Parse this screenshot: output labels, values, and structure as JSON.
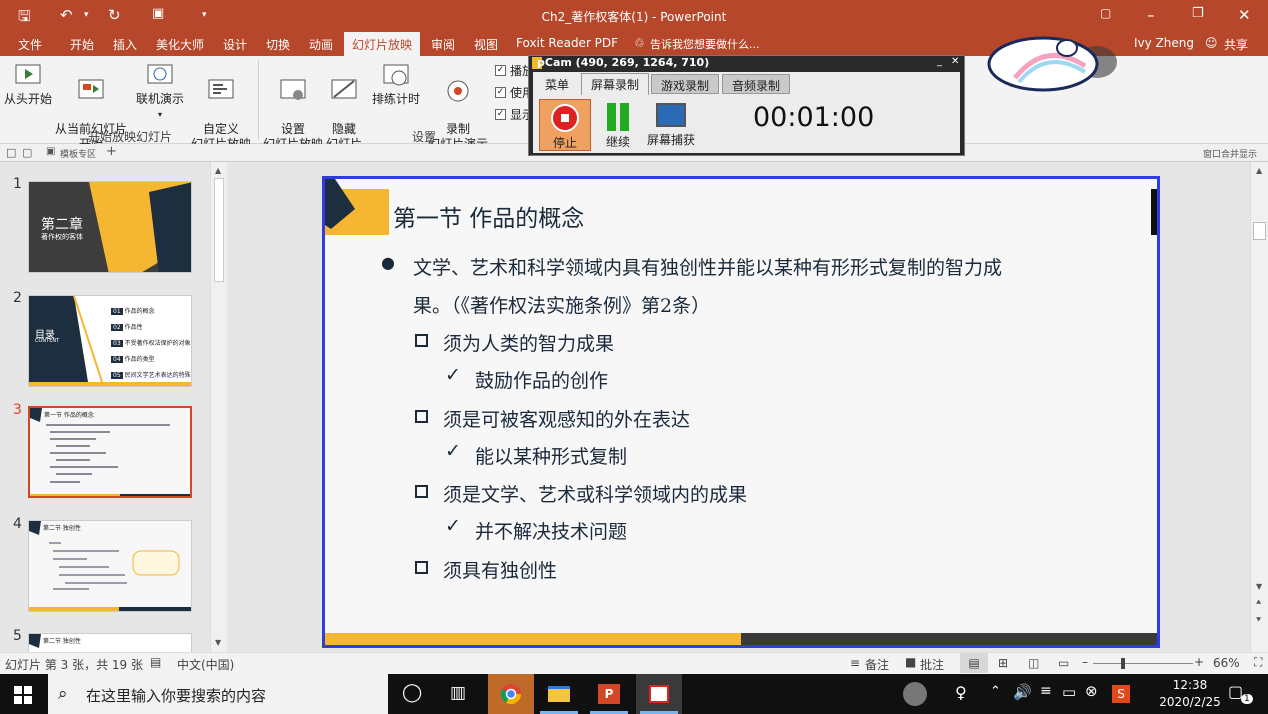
{
  "window": {
    "title": "Ch2_著作权客体(1)  -  PowerPoint",
    "user": "Ivy Zheng",
    "share_label": "共享"
  },
  "menu": {
    "items": [
      "文件",
      "开始",
      "插入",
      "美化大师",
      "设计",
      "切换",
      "动画",
      "幻灯片放映",
      "审阅",
      "视图",
      "Foxit Reader PDF"
    ],
    "active": "幻灯片放映",
    "tell_me": "告诉我您想要做什么..."
  },
  "ribbon": {
    "buttons": [
      "从头开始",
      "从当前幻灯片\n开始",
      "联机演示",
      "自定义\n幻灯片放映",
      "设置\n幻灯片放映",
      "隐藏\n幻灯片",
      "排练计时",
      "录制\n幻灯片演示"
    ],
    "groups": [
      "开始放映幻灯片",
      "设置"
    ],
    "checkboxes": [
      "播放",
      "使用",
      "显示"
    ]
  },
  "tabstrip": {
    "template_tab": "模板专区",
    "right_label": "窗口合并显示"
  },
  "thumbnails": {
    "numbers": [
      "1",
      "2",
      "3",
      "4",
      "5"
    ],
    "t1_title": "第二章",
    "t1_subtitle": "著作权的客体",
    "t2_title": "目录",
    "t2_sub": "CONTENT",
    "t2_items": [
      "作品的概念",
      "作品性",
      "不受著作权法保护的对象",
      "作品的类型",
      "民间文学艺术表达的特殊问题"
    ],
    "t2_nums": [
      "01",
      "02",
      "03",
      "04",
      "05"
    ],
    "t3_title": "第一节 作品的概念",
    "t4_title": "第二节 独创性",
    "t5_title": "第二节 独创性"
  },
  "slide": {
    "title": "第一节 作品的概念",
    "bullet_line1": "文学、艺术和科学领域内具有独创性并能以某种有形形式复制的智力成",
    "bullet_line2": "果。（《著作权法实施条例》第2条）",
    "items": [
      {
        "text": "须为人类的智力成果",
        "sub": "鼓励作品的创作"
      },
      {
        "text": "须是可被客观感知的外在表达",
        "sub": "能以某种形式复制"
      },
      {
        "text": "须是文学、艺术或科学领域内的成果",
        "sub": "并不解决技术问题"
      },
      {
        "text": "须具有独创性",
        "sub": ""
      }
    ],
    "accent": "#f5b731",
    "dark": "#1d2f3f"
  },
  "statusbar": {
    "slide_info": "幻灯片 第 3 张，共 19 张",
    "language": "中文(中国)",
    "notes": "备注",
    "comments": "批注",
    "zoom": "66%"
  },
  "bdcam": {
    "title": "pCam (490, 269, 1264, 710)",
    "tabs": [
      "菜单",
      "屏幕录制",
      "游戏录制",
      "音频录制"
    ],
    "active_tab": "屏幕录制",
    "stop": "停止",
    "resume": "继续",
    "capture": "屏幕捕获",
    "timer": "00:01:00"
  },
  "taskbar": {
    "search_placeholder": "在这里输入你要搜索的内容",
    "time": "12:38",
    "date": "2020/2/25",
    "notify_count": "1"
  }
}
